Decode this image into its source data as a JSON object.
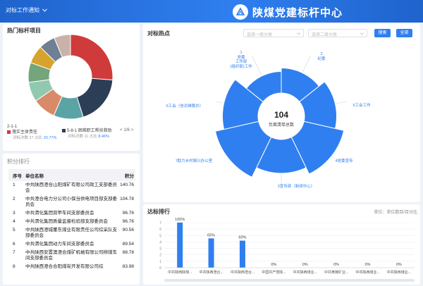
{
  "header": {
    "menu_label": "对标工作通知",
    "title": "陕煤党建标杆中心"
  },
  "hot_items": {
    "title": "热门标杆项目",
    "legend": [
      {
        "code": "2-1-1",
        "name": "落实主体责任",
        "sub_prefix": "对标次数 27 占比",
        "pct": "20.77%",
        "color": "#cf3b3b"
      },
      {
        "code": "5-8-1",
        "name": "困难职工帮扶救助",
        "sub_prefix": "对标次数 11 占比",
        "pct": "8.46%",
        "color": "#2c3e55"
      }
    ],
    "pager": {
      "prev": "<",
      "text": "1/6",
      "next": ">"
    }
  },
  "donut_slices": [
    {
      "value": 20.77,
      "color": "#cf3b3b"
    },
    {
      "value": 15.0,
      "color": "#2c3e55"
    },
    {
      "value": 9.0,
      "color": "#5ca3a6"
    },
    {
      "value": 7.0,
      "color": "#d98a68"
    },
    {
      "value": 6.0,
      "color": "#90c9b0"
    },
    {
      "value": 6.0,
      "color": "#75a57a"
    },
    {
      "value": 5.5,
      "color": "#d6a32e"
    },
    {
      "value": 5.0,
      "color": "#6f7f94"
    },
    {
      "value": 5.0,
      "color": "#c8b2a9"
    }
  ],
  "ranking": {
    "title": "积分排行",
    "columns": [
      "序号",
      "单位名称",
      "积分"
    ],
    "rows": [
      {
        "no": "1",
        "name": "中共陕西澄合山阳煤矿有限公司政工支部委员会",
        "score": "140.76"
      },
      {
        "no": "2",
        "name": "中共澄合电力分公司小保当供电项目部支部委员会",
        "score": "104.78"
      },
      {
        "no": "3",
        "name": "中共渭化集团双甲车间支部委员会",
        "score": "96.76"
      },
      {
        "no": "4",
        "name": "中共渭化集团质量监督检验部支部委员会",
        "score": "96.76"
      },
      {
        "no": "5",
        "name": "中共陕西澄城董东煤业有限责任公司综采队支部委员会",
        "score": "90.56"
      },
      {
        "no": "6",
        "name": "中共渭化集团动力车间支部委员会",
        "score": "89.54"
      },
      {
        "no": "7",
        "name": "中共陕西安置澳澄合煤矿机械有限公司柳煤车间支部委员会",
        "score": "88.78"
      },
      {
        "no": "8",
        "name": "中共陕西澄合合阳煤炭开发有限公司综",
        "score": "83.98"
      }
    ]
  },
  "hotspot": {
    "title": "对标热点",
    "select1_placeholder": "选择一级分类",
    "select2_placeholder": "选择二级分类",
    "search_label": "搜索",
    "all_label": "全部",
    "center_value": "104",
    "center_label": "负面清单总数",
    "labels": [
      "1\n党委\n工作部\n(组织部)工作",
      "2\n纪委",
      "5工会工作",
      "4党委宣传",
      "3宣传部（新闻中心）",
      "7助力乡村振兴办公室",
      "6工会（信访维稳办）"
    ],
    "sectors": [
      {
        "value": 0.35
      },
      {
        "value": 0.55
      },
      {
        "value": 0.8
      },
      {
        "value": 0.6
      },
      {
        "value": 0.9
      },
      {
        "value": 0.65
      },
      {
        "value": 0.25
      }
    ]
  },
  "compliance": {
    "title": "达标排行",
    "unit_label": "单位：单位数目/百分比",
    "y_ticks": [
      "0",
      "1",
      "2",
      "3",
      "4",
      "5",
      "6",
      "7"
    ],
    "chart_data": {
      "type": "bar",
      "categories": [
        "中共陕西陕煤...",
        "中共陕西澄合...",
        "中共陕西澄合...",
        "中国共产党陕...",
        "中共陕西煤业...",
        "中共黄陵矿业...",
        "中共陕西煤业...",
        "中共陕西煤业..."
      ],
      "values": [
        100,
        65,
        60,
        0,
        0,
        0,
        0,
        0
      ],
      "value_labels": [
        "100%",
        "65%",
        "60%",
        "0%",
        "0%",
        "0%",
        "0%",
        "0%"
      ],
      "ylim": [
        0,
        100
      ]
    }
  }
}
